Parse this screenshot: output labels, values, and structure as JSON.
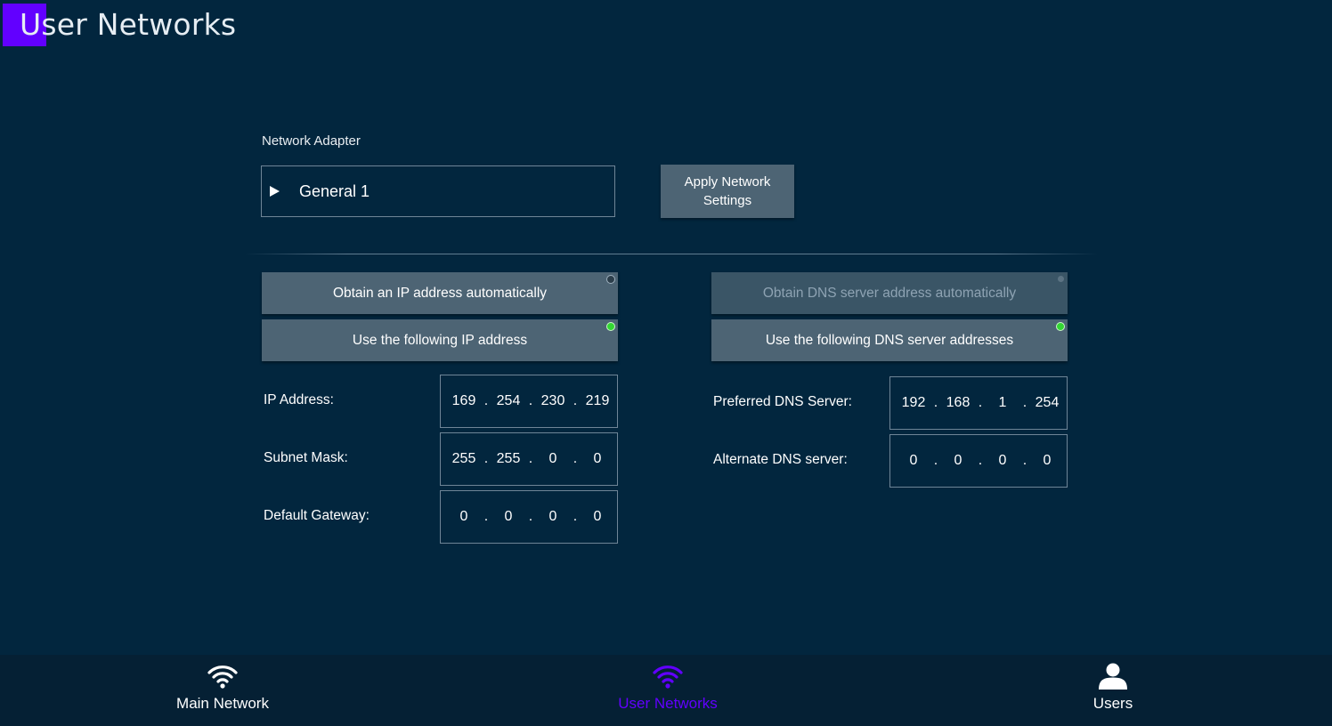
{
  "page": {
    "title": "User Networks",
    "accent_color": "#6200ff",
    "background": "#02263e"
  },
  "adapter": {
    "label": "Network Adapter",
    "selected": "General 1",
    "apply_button": "Apply Network Settings"
  },
  "ip": {
    "auto_option": "Obtain an IP address automatically",
    "auto_selected": false,
    "manual_option": "Use the following IP address",
    "manual_selected": true,
    "fields": [
      {
        "label": "IP Address:",
        "octets": [
          "169",
          "254",
          "230",
          "219"
        ]
      },
      {
        "label": "Subnet Mask:",
        "octets": [
          "255",
          "255",
          "0",
          "0"
        ]
      },
      {
        "label": "Default Gateway:",
        "octets": [
          "0",
          "0",
          "0",
          "0"
        ]
      }
    ]
  },
  "dns": {
    "auto_option": "Obtain DNS server address automatically",
    "auto_enabled": false,
    "manual_option": "Use the following DNS server addresses",
    "manual_selected": true,
    "fields": [
      {
        "label": "Preferred DNS Server:",
        "octets": [
          "192",
          "168",
          "1",
          "254"
        ]
      },
      {
        "label": "Alternate DNS server:",
        "octets": [
          "0",
          "0",
          "0",
          "0"
        ]
      }
    ]
  },
  "nav": {
    "items": [
      {
        "label": "Main Network",
        "icon": "wifi-icon",
        "active": false
      },
      {
        "label": "User Networks",
        "icon": "wifi-icon",
        "active": true
      },
      {
        "label": "Users",
        "icon": "user-icon",
        "active": false
      }
    ],
    "active_color": "#6200ff"
  }
}
